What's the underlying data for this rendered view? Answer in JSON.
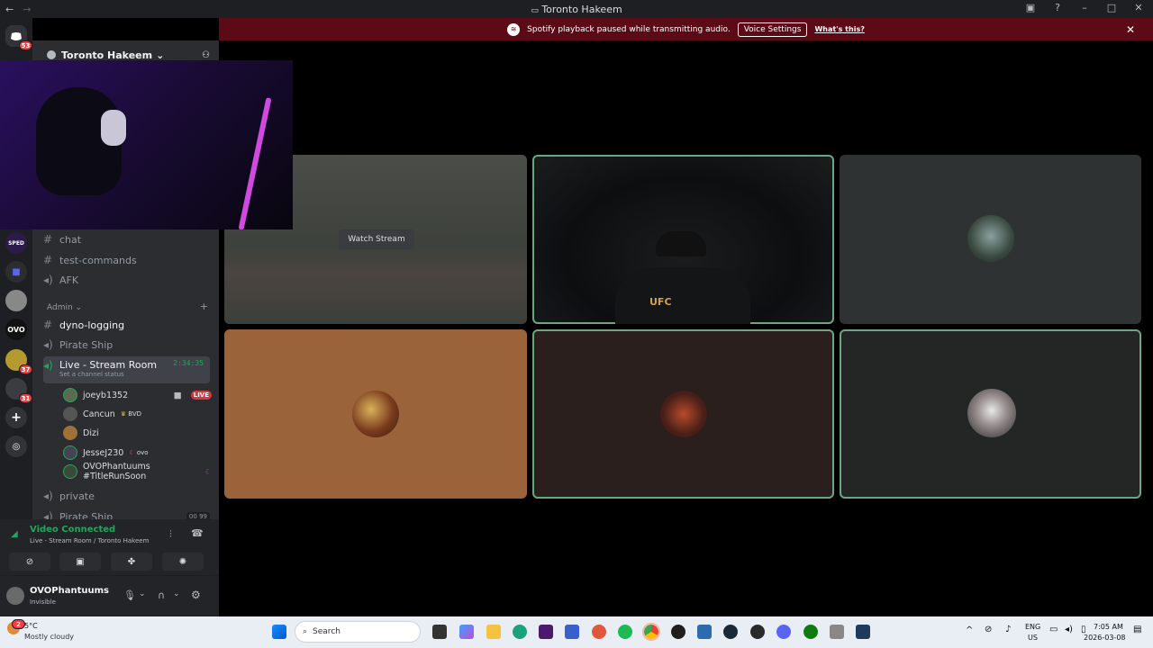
{
  "window": {
    "title": "Toronto Hakeem",
    "nav_back": "←",
    "nav_fwd": "→"
  },
  "rail": {
    "home_badge": "53",
    "badges": [
      "37",
      "31"
    ],
    "server_labels": [
      "OVO"
    ]
  },
  "server": {
    "name": "Toronto Hakeem",
    "chevron": "⌄"
  },
  "channels": {
    "list": [
      {
        "name": "chat"
      },
      {
        "name": "test-commands"
      },
      {
        "name": "AFK"
      }
    ],
    "admin_category": "Admin",
    "admin_list": [
      {
        "name": "dyno-logging"
      },
      {
        "name": "Pirate Ship"
      }
    ],
    "voice": {
      "name": "Live - Stream Room",
      "timer": "2:34:35",
      "status": "Set a channel status"
    },
    "members": [
      {
        "name": "joeyb1352",
        "tag": "",
        "live": "LIVE"
      },
      {
        "name": "Cancun",
        "tag": "BVD",
        "live": ""
      },
      {
        "name": "Dizi",
        "tag": "",
        "live": ""
      },
      {
        "name": "JesseJ230",
        "tag": "ovo",
        "live": ""
      },
      {
        "name": "OVOPhantuums #TitleRunSoon",
        "tag": "",
        "live": ""
      }
    ],
    "after": [
      {
        "name": "private"
      },
      {
        "name": "Pirate Ship"
      }
    ],
    "after_counts": [
      "00",
      "99"
    ]
  },
  "voice_panel": {
    "status": "Video Connected",
    "location": "Live - Stream Room / Toronto Hakeem"
  },
  "user_panel": {
    "name": "OVOPhantuums",
    "status": "Invisible"
  },
  "notice": {
    "text": "Spotify playback paused while transmitting audio.",
    "button": "Voice Settings",
    "link": "What's this?",
    "close": "✕"
  },
  "stage": {
    "watch_stream": "Watch Stream"
  },
  "taskbar": {
    "weather_temp": "5°C",
    "weather_desc": "Mostly cloudy",
    "weather_badge": "2",
    "search": "Search",
    "lang": "ENG",
    "region": "US",
    "time": "7:05 AM",
    "date": "2026-03-08"
  },
  "colors": {
    "accent_green": "#23a55a",
    "speaking_outline": "#6aa684",
    "notice_bg": "#5c0b16",
    "live_red": "#da373c"
  }
}
